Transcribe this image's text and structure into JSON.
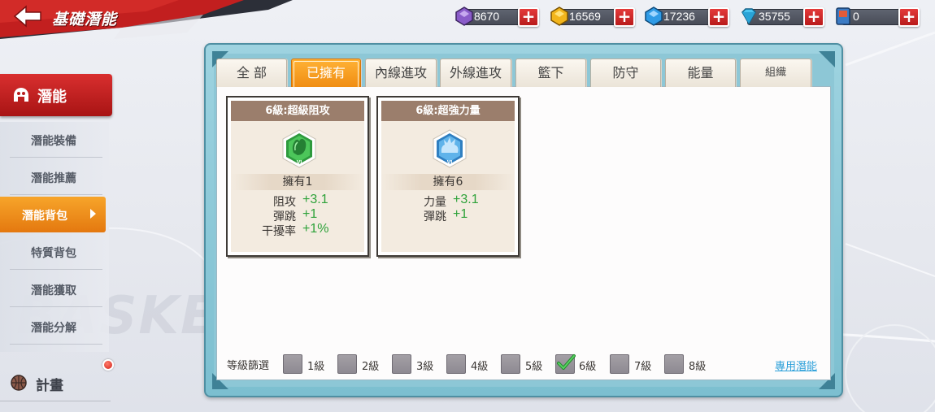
{
  "header": {
    "title": "基礎潛能"
  },
  "currencies": [
    {
      "name": "purple-gem",
      "value": "8670",
      "color": "#8a5cc9"
    },
    {
      "name": "gold-coin",
      "value": "16569",
      "color": "#f2b51c"
    },
    {
      "name": "blue-crystal",
      "value": "17236",
      "color": "#2f9be6"
    },
    {
      "name": "diamond",
      "value": "35755",
      "color": "#4cc6f2"
    },
    {
      "name": "card-ticket",
      "value": "0",
      "color": "#3b7bc4"
    }
  ],
  "sidebar": {
    "main_label": "潛能",
    "items": [
      {
        "label": "潛能裝備",
        "active": false
      },
      {
        "label": "潛能推薦",
        "active": false
      },
      {
        "label": "潛能背包",
        "active": true
      },
      {
        "label": "特質背包",
        "active": false
      },
      {
        "label": "潛能獲取",
        "active": false
      },
      {
        "label": "潛能分解",
        "active": false
      }
    ],
    "plan_label": "計畫"
  },
  "tabs": [
    {
      "label": "全 部",
      "active": false
    },
    {
      "label": "已擁有",
      "active": true
    },
    {
      "label": "內線進攻",
      "active": false
    },
    {
      "label": "外線進攻",
      "active": false
    },
    {
      "label": "籃下",
      "active": false
    },
    {
      "label": "防守",
      "active": false
    },
    {
      "label": "能量",
      "active": false
    },
    {
      "label": "組織",
      "active": false
    }
  ],
  "cards": [
    {
      "title": "6級:超級阻攻",
      "icon": "green-hand-emblem",
      "owned": "擁有1",
      "stats": [
        {
          "name": "阻攻",
          "value": "+3.1"
        },
        {
          "name": "彈跳",
          "value": "+1"
        },
        {
          "name": "干擾率",
          "value": "+1%"
        }
      ]
    },
    {
      "title": "6級:超強力量",
      "icon": "blue-splash-emblem",
      "owned": "擁有6",
      "stats": [
        {
          "name": "力量",
          "value": "+3.1"
        },
        {
          "name": "彈跳",
          "value": "+1"
        }
      ]
    }
  ],
  "filter": {
    "label": "等級篩選",
    "levels": [
      {
        "label": "1級",
        "checked": false
      },
      {
        "label": "2級",
        "checked": false
      },
      {
        "label": "3級",
        "checked": false
      },
      {
        "label": "4級",
        "checked": false
      },
      {
        "label": "5級",
        "checked": false
      },
      {
        "label": "6級",
        "checked": true
      },
      {
        "label": "7級",
        "checked": false
      },
      {
        "label": "8級",
        "checked": false
      }
    ]
  },
  "link_label": "專用潛能",
  "background_text": "BASKET",
  "colors": {
    "accent_orange": "#f08d12",
    "brand_red": "#c21f1f",
    "panel_teal": "#8dc7d6",
    "stat_green": "#2ea23a",
    "link_blue": "#2b9fd9"
  }
}
